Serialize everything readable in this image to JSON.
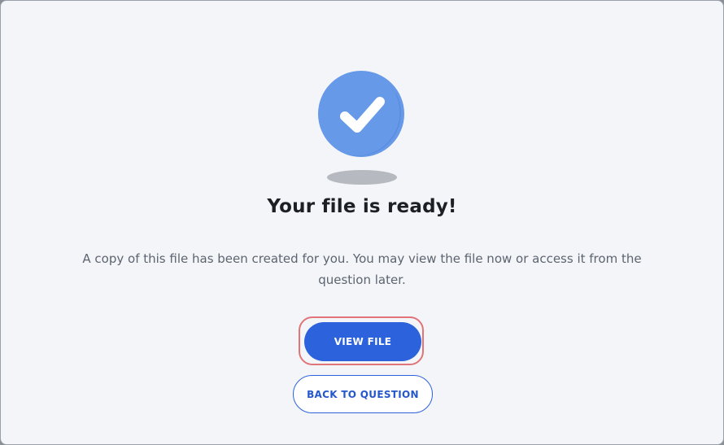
{
  "dialog": {
    "title": "Your file is ready!",
    "message": "A copy of this file has been created for you. You may view the file now or access it from the question later.",
    "icon": "check-circle-icon",
    "primary_button": {
      "label": "VIEW FILE",
      "focused": true
    },
    "secondary_button": {
      "label": "BACK TO QUESTION"
    }
  },
  "colors": {
    "accent": "#2c62dc",
    "check_circle": "#6699e8",
    "focus_ring": "#e07478",
    "background": "#f3f5f9"
  }
}
